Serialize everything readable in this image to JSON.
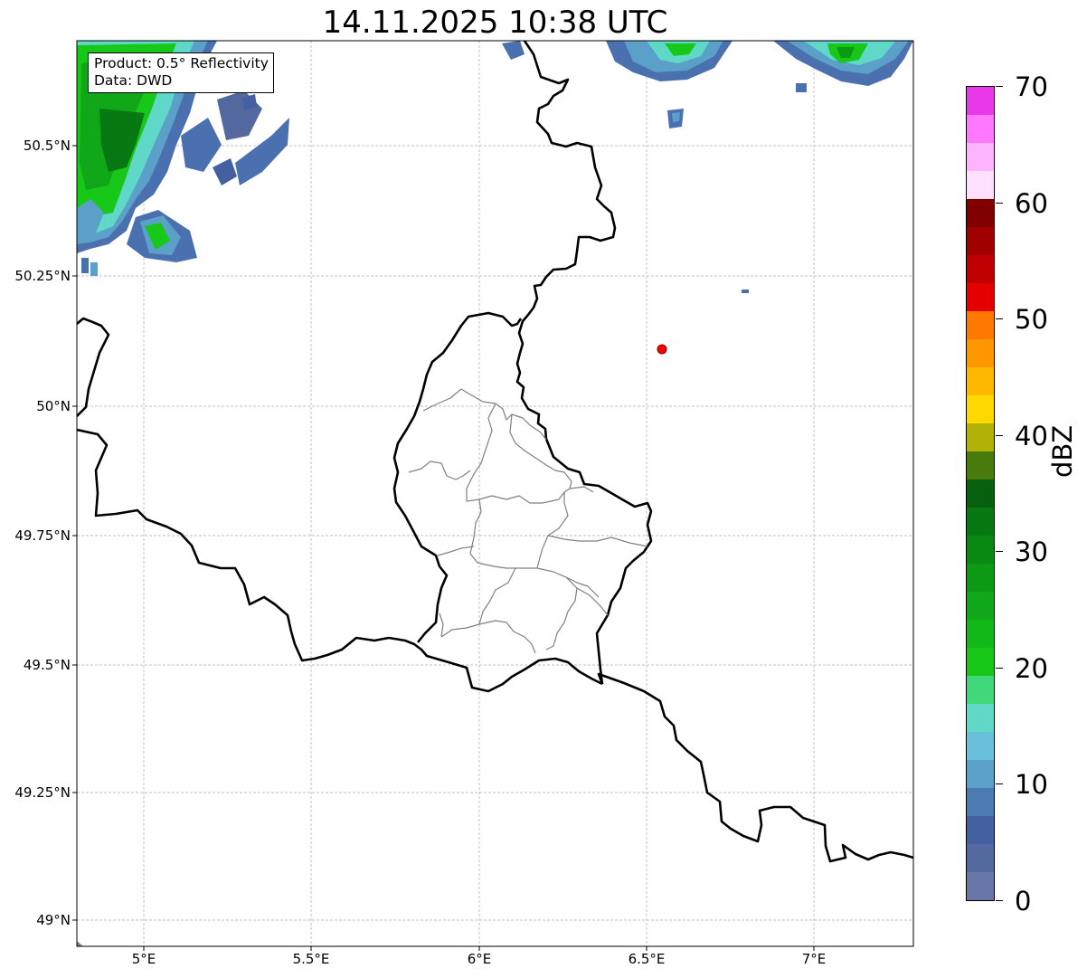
{
  "title": "14.11.2025 10:38 UTC",
  "info_box": {
    "product": "Product: 0.5° Reflectivity",
    "source": "Data: DWD"
  },
  "map": {
    "lat_ticks": [
      "50.5°N",
      "50.25°N",
      "50°N",
      "49.75°N",
      "49.5°N",
      "49.25°N",
      "49°N"
    ],
    "lon_ticks": [
      "5°E",
      "5.5°E",
      "6°E",
      "6.5°E",
      "7°E"
    ],
    "marker": {
      "label": "radar-site",
      "color": "#ff0000",
      "lon": 6.55,
      "lat": 50.11
    },
    "gridline_color": "#aaaaaa",
    "border_color": "#000000",
    "district_color": "#808080"
  },
  "colorbar": {
    "unit": "dBZ",
    "ticks": [
      "0",
      "10",
      "20",
      "30",
      "40",
      "50",
      "60",
      "70"
    ],
    "range": [
      0,
      70
    ],
    "colors": [
      "#6877a8",
      "#5468a0",
      "#4560a0",
      "#4a7ab0",
      "#5aa0c8",
      "#68c0dc",
      "#60d8c8",
      "#40d878",
      "#18c818",
      "#12b818",
      "#10a818",
      "#0c9a14",
      "#0a8a12",
      "#087812",
      "#06600e",
      "#487a0c",
      "#b0b208",
      "#ffd800",
      "#ffb800",
      "#ff9800",
      "#ff7800",
      "#e40000",
      "#c00000",
      "#a00000",
      "#800000",
      "#ffe0ff",
      "#ffb4ff",
      "#ff78ff",
      "#e838e8"
    ]
  }
}
